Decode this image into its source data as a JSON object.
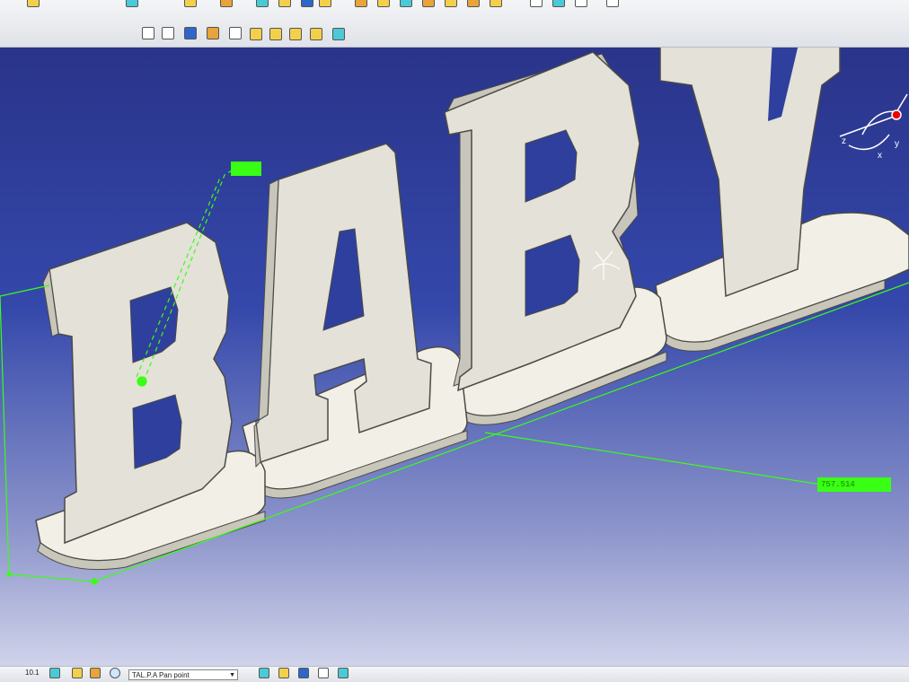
{
  "app": {
    "viewport_background": [
      "#2b2f86",
      "#3346a8",
      "#8f96c9",
      "#d4d6ec"
    ],
    "part_color": "#e3e1d8",
    "base_color": "#f1efe6",
    "edge_color": "#4a4a48",
    "selection_color": "#39ff14"
  },
  "model": {
    "letters": [
      "B",
      "A",
      "B",
      "Y"
    ]
  },
  "dimensions": {
    "tag_top": "",
    "tag_right": "757.514"
  },
  "axis": {
    "label_x": "x",
    "label_y": "y",
    "label_z": "z"
  },
  "bottom_toolbar": {
    "coord_text": "10.1",
    "combo_value": "TAL.P.A Pan point"
  },
  "toolbar_icons": [
    "sketch-icon",
    "fillet-icon",
    "chamfer-icon",
    "shell-icon",
    "pocket-icon",
    "pad-icon",
    "revolve-icon",
    "draft-icon",
    "mirror-icon",
    "rotate-icon"
  ]
}
